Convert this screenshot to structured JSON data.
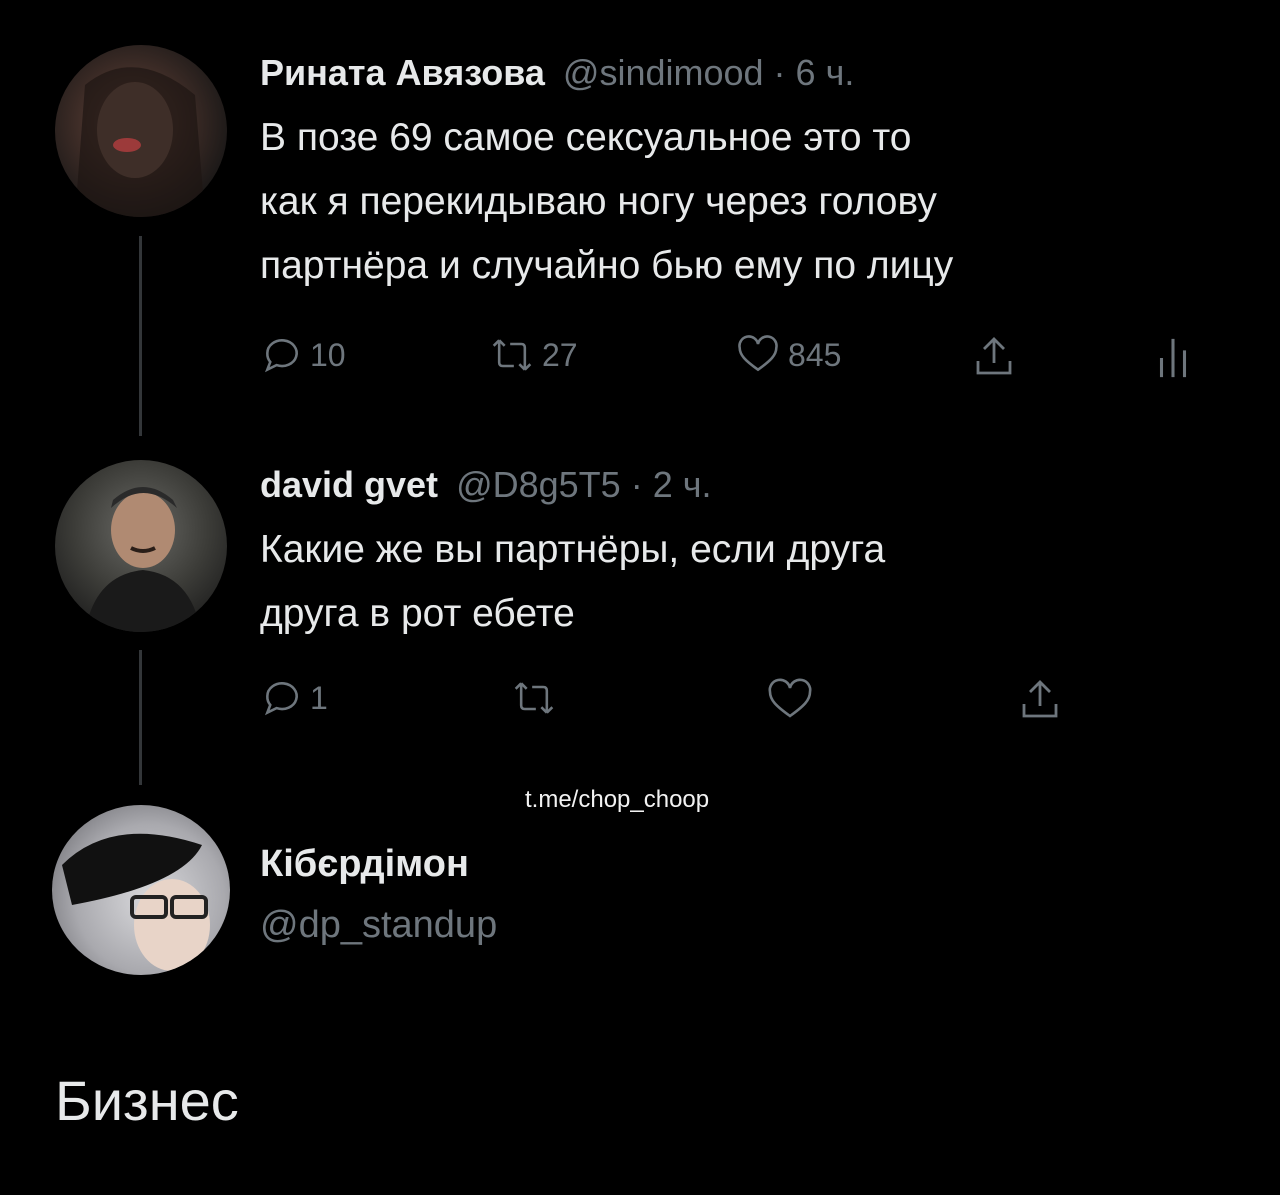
{
  "tweets": [
    {
      "author": "Рината Авязова",
      "handle": "@sindimood",
      "sep": " · ",
      "time": "6 ч.",
      "text_lines": [
        "В позе 69 самое сексуальное это то",
        "как я перекидываю ногу через голову",
        "партнёра и случайно бью ему по лицу"
      ],
      "replies": "10",
      "retweets": "27",
      "likes": "845"
    },
    {
      "author": "david gvet",
      "handle": "@D8g5T5",
      "sep": " · ",
      "time": "2 ч.",
      "text_lines": [
        "Какие же вы партнёры, если друга",
        "друга в рот ебете"
      ],
      "replies": "1"
    }
  ],
  "profile": {
    "name": "Кібєрдімон",
    "handle": "@dp_standup"
  },
  "watermark": "t.me/chop_choop",
  "caption": "Бизнес",
  "icons": {
    "reply": "reply-icon",
    "retweet": "retweet-icon",
    "like": "heart-icon",
    "share": "share-icon",
    "analytics": "analytics-icon"
  },
  "colors": {
    "background": "#000000",
    "text": "#e7e9ea",
    "muted": "#6e767d",
    "line": "#333639"
  }
}
